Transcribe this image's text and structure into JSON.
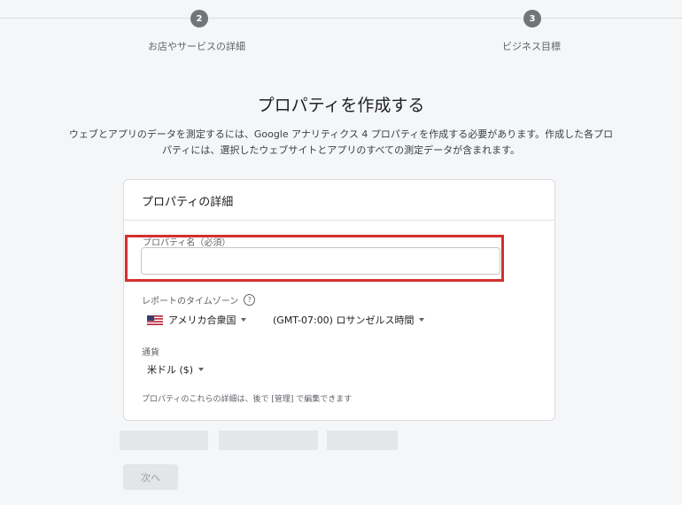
{
  "stepper": {
    "steps": [
      {
        "number": "2",
        "label": "お店やサービスの詳細"
      },
      {
        "number": "3",
        "label": "ビジネス目標"
      }
    ]
  },
  "page": {
    "title": "プロパティを作成する",
    "description_line1": "ウェブとアプリのデータを測定するには、Google アナリティクス 4 プロパティを作成する必要があります。作成した各プロ",
    "description_line2": "パティには、選択したウェブサイトとアプリのすべての測定データが含まれます。"
  },
  "card": {
    "header": "プロパティの詳細",
    "property_name_label": "プロパティ名（必須）",
    "property_name_value": "",
    "timezone_label": "レポートのタイムゾーン",
    "help_glyph": "?",
    "country_value": "アメリカ合衆国",
    "timezone_value": "(GMT-07:00) ロサンゼルス時間",
    "currency_label": "通貨",
    "currency_value": "米ドル ($)",
    "footnote": "プロパティのこれらの詳細は、後で [管理] で編集できます"
  },
  "footer": {
    "next_button": "次へ"
  },
  "colors": {
    "highlight": "#d32f2f",
    "step_circle": "#70757a"
  }
}
